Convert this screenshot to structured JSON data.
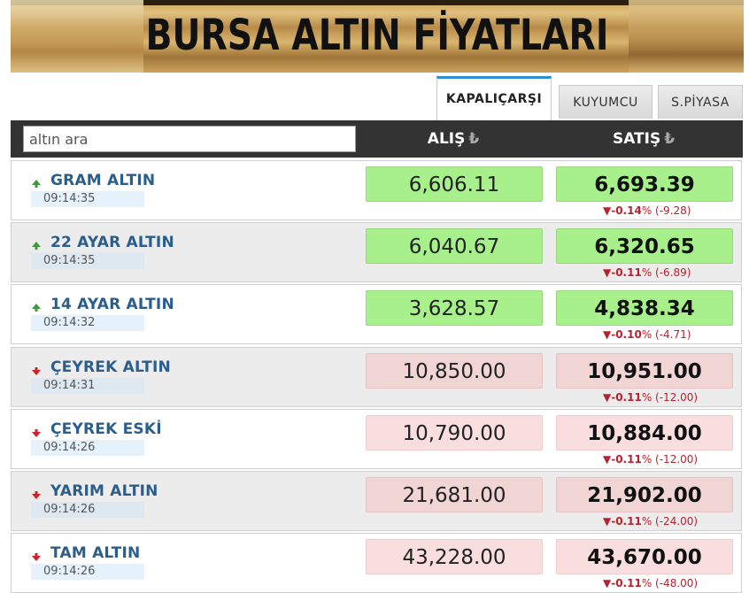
{
  "banner": {
    "title": "BURSA ALTIN FİYATLARI"
  },
  "tabs": [
    {
      "label": "KAPALIÇARŞI",
      "active": true
    },
    {
      "label": "KUYUMCU",
      "active": false
    },
    {
      "label": "S.PİYASA",
      "active": false
    }
  ],
  "search": {
    "placeholder": "altın ara"
  },
  "columns": {
    "buy": "ALIŞ",
    "sell": "SATIŞ",
    "currency_icon": "₺"
  },
  "colors": {
    "header_bg": "#333333",
    "up_bg": "#a8f08c",
    "down_bg": "#f1d4d4",
    "name": "#2b5e8c",
    "change": "#b7222e",
    "tab_active_border": "#2f8fd6"
  },
  "rows": [
    {
      "name": "GRAM ALTIN",
      "time": "09:14:35",
      "direction": "up",
      "buy": "6,606.11",
      "sell": "6,693.39",
      "change_pct": "▼-0.14",
      "change_abs": "% (-9.28)"
    },
    {
      "name": "22 AYAR ALTIN",
      "time": "09:14:35",
      "direction": "up",
      "buy": "6,040.67",
      "sell": "6,320.65",
      "change_pct": "▼-0.11",
      "change_abs": "% (-6.89)"
    },
    {
      "name": "14 AYAR ALTIN",
      "time": "09:14:32",
      "direction": "up",
      "buy": "3,628.57",
      "sell": "4,838.34",
      "change_pct": "▼-0.10",
      "change_abs": "% (-4.71)"
    },
    {
      "name": "ÇEYREK ALTIN",
      "time": "09:14:31",
      "direction": "down",
      "buy": "10,850.00",
      "sell": "10,951.00",
      "change_pct": "▼-0.11",
      "change_abs": "% (-12.00)"
    },
    {
      "name": "ÇEYREK ESKİ",
      "time": "09:14:26",
      "direction": "down",
      "buy": "10,790.00",
      "sell": "10,884.00",
      "change_pct": "▼-0.11",
      "change_abs": "% (-12.00)"
    },
    {
      "name": "YARIM ALTIN",
      "time": "09:14:26",
      "direction": "down",
      "buy": "21,681.00",
      "sell": "21,902.00",
      "change_pct": "▼-0.11",
      "change_abs": "% (-24.00)"
    },
    {
      "name": "TAM ALTIN",
      "time": "09:14:26",
      "direction": "down",
      "buy": "43,228.00",
      "sell": "43,670.00",
      "change_pct": "▼-0.11",
      "change_abs": "% (-48.00)"
    }
  ]
}
